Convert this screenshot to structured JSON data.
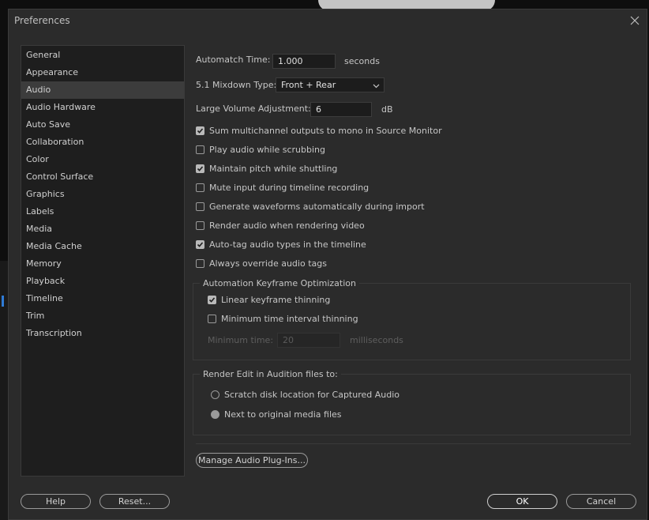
{
  "window": {
    "title": "Preferences"
  },
  "sidebar": {
    "items": [
      {
        "label": "General"
      },
      {
        "label": "Appearance"
      },
      {
        "label": "Audio"
      },
      {
        "label": "Audio Hardware"
      },
      {
        "label": "Auto Save"
      },
      {
        "label": "Collaboration"
      },
      {
        "label": "Color"
      },
      {
        "label": "Control Surface"
      },
      {
        "label": "Graphics"
      },
      {
        "label": "Labels"
      },
      {
        "label": "Media"
      },
      {
        "label": "Media Cache"
      },
      {
        "label": "Memory"
      },
      {
        "label": "Playback"
      },
      {
        "label": "Timeline"
      },
      {
        "label": "Trim"
      },
      {
        "label": "Transcription"
      }
    ],
    "selected": "Audio"
  },
  "audio": {
    "automatch": {
      "label": "Automatch Time:",
      "value": "1.000",
      "unit": "seconds"
    },
    "mixdown": {
      "label": "5.1 Mixdown Type:",
      "value": "Front + Rear"
    },
    "volume": {
      "label": "Large Volume Adjustment:",
      "value": "6",
      "unit": "dB"
    },
    "options": [
      {
        "label": "Sum multichannel outputs to mono in Source Monitor",
        "checked": true
      },
      {
        "label": "Play audio while scrubbing",
        "checked": false
      },
      {
        "label": "Maintain pitch while shuttling",
        "checked": true
      },
      {
        "label": "Mute input during timeline recording",
        "checked": false
      },
      {
        "label": "Generate waveforms automatically during import",
        "checked": false
      },
      {
        "label": "Render audio when rendering video",
        "checked": false
      },
      {
        "label": "Auto-tag audio types in the timeline",
        "checked": true
      },
      {
        "label": "Always override audio tags",
        "checked": false
      }
    ],
    "keyframe_group": {
      "title": "Automation Keyframe Optimization",
      "linear": {
        "label": "Linear keyframe thinning",
        "checked": true
      },
      "min_interval": {
        "label": "Minimum time interval thinning",
        "checked": false
      },
      "min_time": {
        "label": "Minimum time:",
        "value": "20",
        "unit": "milliseconds"
      }
    },
    "audition_group": {
      "title": "Render Edit in Audition files to:",
      "scratch": {
        "label": "Scratch disk location for Captured Audio",
        "selected": false
      },
      "next_to": {
        "label": "Next to original media files",
        "selected": true
      }
    },
    "plugins_button": "Manage Audio Plug-Ins..."
  },
  "footer": {
    "help": "Help",
    "reset": "Reset...",
    "ok": "OK",
    "cancel": "Cancel"
  }
}
